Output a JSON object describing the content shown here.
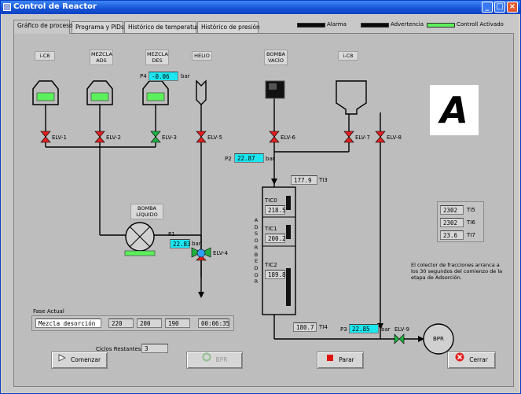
{
  "window": {
    "title": "Control de Reactor"
  },
  "tabs": [
    {
      "label": "Gráfico de proceso"
    },
    {
      "label": "Programa y PIDs"
    },
    {
      "label": "Histórico de temperatura"
    },
    {
      "label": "Histórico de presión"
    }
  ],
  "legend": {
    "alarma": "Alarma",
    "advertencia": "Advertencia",
    "control": "Controll Activado"
  },
  "sources": {
    "s1": "i-C8",
    "s2": "MEZCLA\nADS",
    "s3": "MEZCLA\nDES",
    "s4": "HELIO",
    "s5": "BOMBA\nVACÍO",
    "s6": "i-C8"
  },
  "pressures": {
    "p4_label": "P4",
    "p4_value": "-0.06",
    "p2_label": "P2",
    "p2_value": "22.87",
    "p1_label": "P1",
    "p1_value": "22.83",
    "p3_label": "P3",
    "p3_value": "22.85",
    "unit": "bar"
  },
  "valves": {
    "v1": "ELV-1",
    "v2": "ELV-2",
    "v3": "ELV-3",
    "v5": "ELV-5",
    "v6": "ELV-6",
    "v7": "ELV-7",
    "v8": "ELV-8",
    "v4": "ELV-4",
    "v9": "ELV-9"
  },
  "reactor": {
    "ti3_value": "177.9",
    "ti3_label": "TI3",
    "adsorbedor": "A D S O R B E D O R",
    "tic0_label": "TIC0",
    "tic0_value": "218.5",
    "tic1_label": "TIC1",
    "tic1_value": "200.2",
    "tic2_label": "TIC2",
    "tic2_value": "189.8",
    "ti4_value": "180.7",
    "ti4_label": "TI4"
  },
  "pump": {
    "label": "BOMBA\nLÍQUIDO"
  },
  "temps": {
    "ti5_value": "2302",
    "ti5_label": "TI5",
    "ti6_value": "2302",
    "ti6_label": "TI6",
    "ti7_value": "23.6",
    "ti7_label": "TI7"
  },
  "note": "El colector de fracciones arranca a los 30 segundos del comienzo de la etapa de Adsorción.",
  "logo": "A",
  "bpr_label": "BPR",
  "phase": {
    "title": "Fase Actual",
    "name": "Mezcla desorción",
    "v1": "220",
    "v2": "200",
    "v3": "190",
    "time": "00:06:35"
  },
  "cycles": {
    "label": "Ciclos Restantes",
    "value": "3"
  },
  "buttons": {
    "start": "Comenzar",
    "bpr": "BPR",
    "stop": "Parar",
    "close": "Cerrar"
  },
  "colors": {
    "valve_red": "#e02020",
    "valve_green": "#20b040",
    "led_green": "#5cf05c",
    "cyan": "#1ce6f0"
  }
}
